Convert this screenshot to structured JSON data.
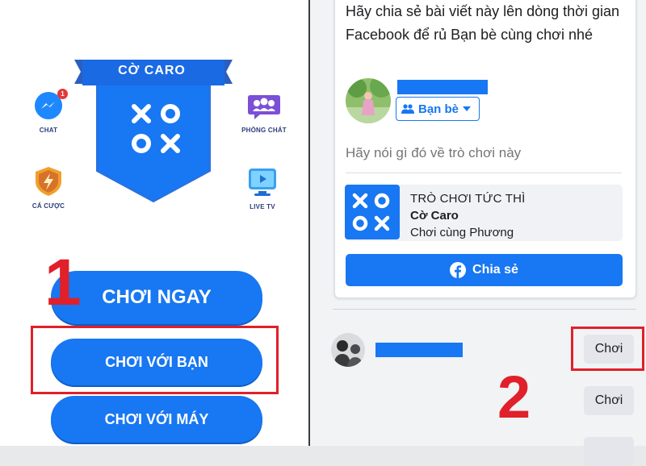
{
  "left": {
    "game_title": "CỜ CARO",
    "side_icons": {
      "chat": "CHAT",
      "chat_badge": "1",
      "room_chat": "PHÒNG CHÁT",
      "betting": "CÁ CƯỢC",
      "live_tv": "LIVE TV"
    },
    "buttons": {
      "play_now": "CHƠI NGAY",
      "play_friends": "CHƠI VỚI BẠN",
      "play_computer": "CHƠI VỚI MÁY"
    },
    "step_marker": "1"
  },
  "right": {
    "share_prompt": "Hãy chia sẻ bài viết này lên dòng thời gian Facebook để rủ Bạn bè cùng chơi nhé",
    "audience_label": "Bạn bè",
    "comment_placeholder": "Hãy nói gì đó về trò chơi này",
    "game_card": {
      "type_label": "TRÒ CHƠI TỨC THÌ",
      "game_name": "Cờ Caro",
      "subtitle": "Chơi cùng Phương"
    },
    "share_button": "Chia sẻ",
    "play_button_1": "Chơi",
    "play_button_2": "Chơi",
    "step_marker": "2"
  },
  "colors": {
    "accent": "#1877f2",
    "highlight": "#e0202a"
  }
}
